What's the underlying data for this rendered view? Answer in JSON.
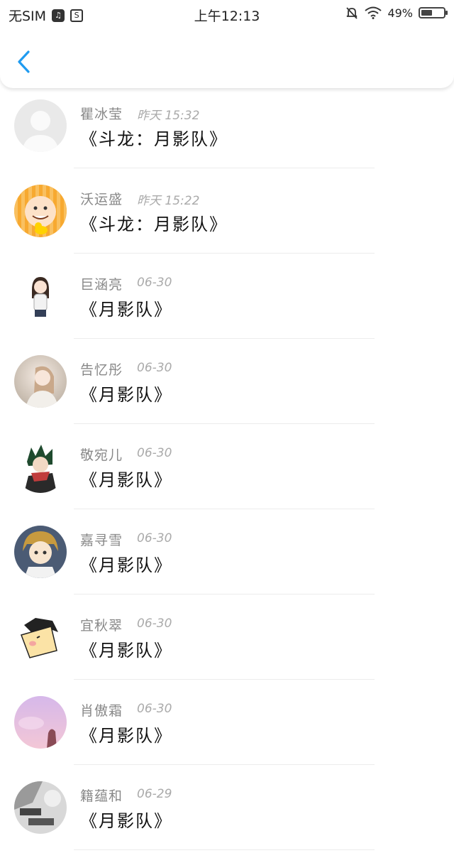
{
  "status_bar": {
    "carrier": "无SIM",
    "time": "上午12:13",
    "battery_percent": "49%",
    "battery_level": 0.49,
    "icons": [
      "music-icon",
      "s-app-icon",
      "silent-bell-icon",
      "wifi-icon",
      "battery-icon"
    ]
  },
  "header": {
    "back_icon": "chevron-left-icon",
    "accent_color": "#1f9bf0"
  },
  "items": [
    {
      "name": "瞿冰莹",
      "time": "昨天 15:32",
      "title": "《斗龙：月影队》",
      "avatar": "default-avatar"
    },
    {
      "name": "沃运盛",
      "time": "昨天 15:22",
      "title": "《斗龙：月影队》",
      "avatar": "cartoon-duck-avatar"
    },
    {
      "name": "巨涵亮",
      "time": "06-30",
      "title": "《月影队》",
      "avatar": "cartoon-girl-avatar"
    },
    {
      "name": "告忆彤",
      "time": "06-30",
      "title": "《月影队》",
      "avatar": "photo-girl-avatar"
    },
    {
      "name": "敬宛儿",
      "time": "06-30",
      "title": "《月影队》",
      "avatar": "anime-boy-avatar"
    },
    {
      "name": "嘉寻雪",
      "time": "06-30",
      "title": "《月影队》",
      "avatar": "anime-blonde-avatar"
    },
    {
      "name": "宜秋翠",
      "time": "06-30",
      "title": "《月影队》",
      "avatar": "cartoon-face-avatar"
    },
    {
      "name": "肖傲霜",
      "time": "06-30",
      "title": "《月影队》",
      "avatar": "pink-sky-avatar"
    },
    {
      "name": "籍蕴和",
      "time": "06-29",
      "title": "《月影队》",
      "avatar": "bw-photo-avatar"
    }
  ]
}
